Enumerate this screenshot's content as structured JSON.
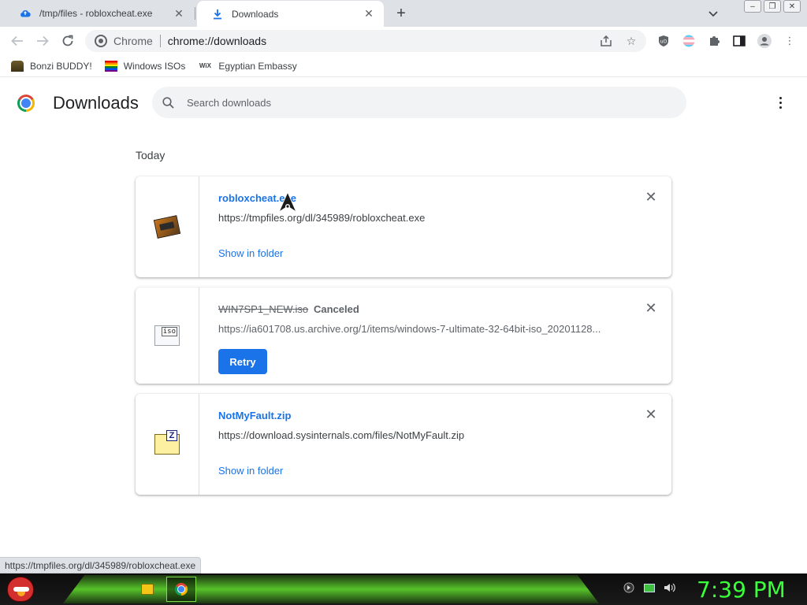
{
  "browser": {
    "tabs": [
      {
        "title": "/tmp/files - robloxcheat.exe",
        "active": false,
        "icon": "cloud-upload-icon"
      },
      {
        "title": "Downloads",
        "active": true,
        "icon": "download-icon"
      }
    ],
    "omnibox": {
      "chip": "Chrome",
      "url": "chrome://downloads"
    },
    "bookmarks": [
      {
        "label": "Bonzi BUDDY!",
        "icon": "bonzi-icon"
      },
      {
        "label": "Windows ISOs",
        "icon": "rainbow-flag-icon"
      },
      {
        "label": "Egyptian Embassy",
        "icon": "wix-icon"
      }
    ]
  },
  "downloads": {
    "title": "Downloads",
    "search_placeholder": "Search downloads",
    "section_date": "Today",
    "items": [
      {
        "name": "robloxcheat.exe",
        "url": "https://tmpfiles.org/dl/345989/robloxcheat.exe",
        "action": "Show in folder",
        "status": ""
      },
      {
        "name": "WIN7SP1_NEW.iso",
        "url": "https://ia601708.us.archive.org/1/items/windows-7-ultimate-32-64bit-iso_20201128...",
        "action": "Retry",
        "status": "Canceled"
      },
      {
        "name": "NotMyFault.zip",
        "url": "https://download.sysinternals.com/files/NotMyFault.zip",
        "action": "Show in folder",
        "status": ""
      }
    ]
  },
  "status_bubble": "https://tmpfiles.org/dl/345989/robloxcheat.exe",
  "taskbar": {
    "clock": "7:39 PM"
  },
  "colors": {
    "link_blue": "#1a73e8",
    "clock_green": "#3aff3a"
  }
}
